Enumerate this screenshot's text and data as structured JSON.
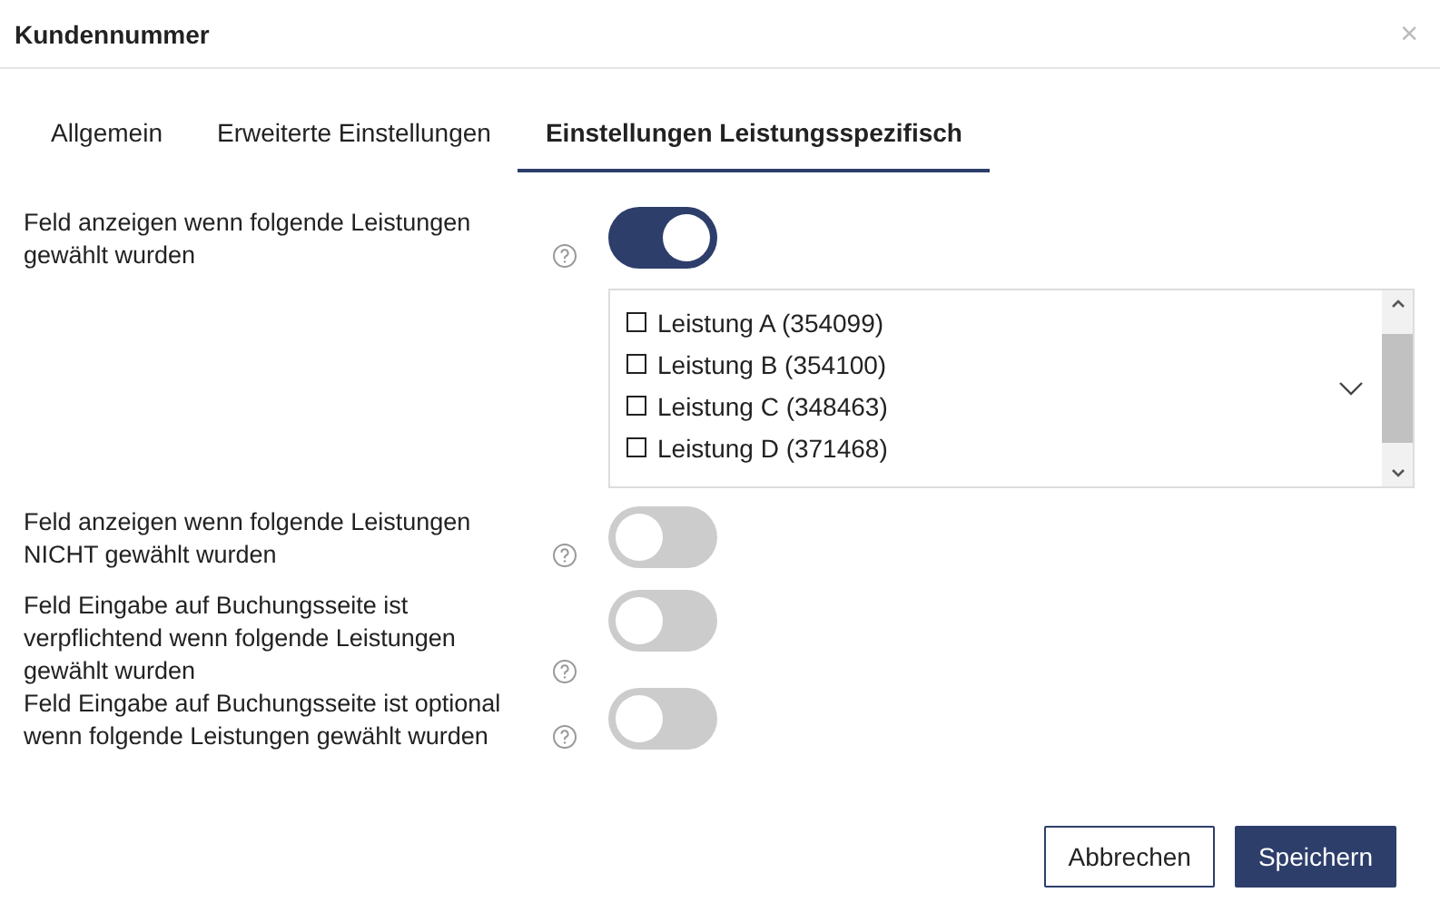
{
  "dialog": {
    "title": "Kundennummer",
    "close": "×"
  },
  "tabs": [
    {
      "label": "Allgemein",
      "selected": false
    },
    {
      "label": "Erweiterte Einstellungen",
      "selected": false
    },
    {
      "label": "Einstellungen Leistungsspezifisch",
      "selected": true
    }
  ],
  "settings": [
    {
      "label": "Feld anzeigen wenn folgende Leistungen gewählt wurden",
      "on": true,
      "list": [
        {
          "label": "Leistung A (354099)",
          "checked": false
        },
        {
          "label": "Leistung B (354100)",
          "checked": false
        },
        {
          "label": "Leistung C (348463)",
          "checked": false
        },
        {
          "label": "Leistung D (371468)",
          "checked": false
        }
      ]
    },
    {
      "label": "Feld anzeigen wenn folgende Leistungen NICHT gewählt wurden",
      "on": false
    },
    {
      "label": "Feld Eingabe auf Buchungsseite ist verpflichtend wenn folgende Leistungen gewählt wurden",
      "on": false
    },
    {
      "label": "Feld Eingabe auf Buchungsseite ist optional wenn folgende Leistungen gewählt wurden",
      "on": false
    }
  ],
  "buttons": [
    {
      "label": "Abbrechen",
      "kind": "secondary"
    },
    {
      "label": "Speichern",
      "kind": "primary"
    }
  ]
}
